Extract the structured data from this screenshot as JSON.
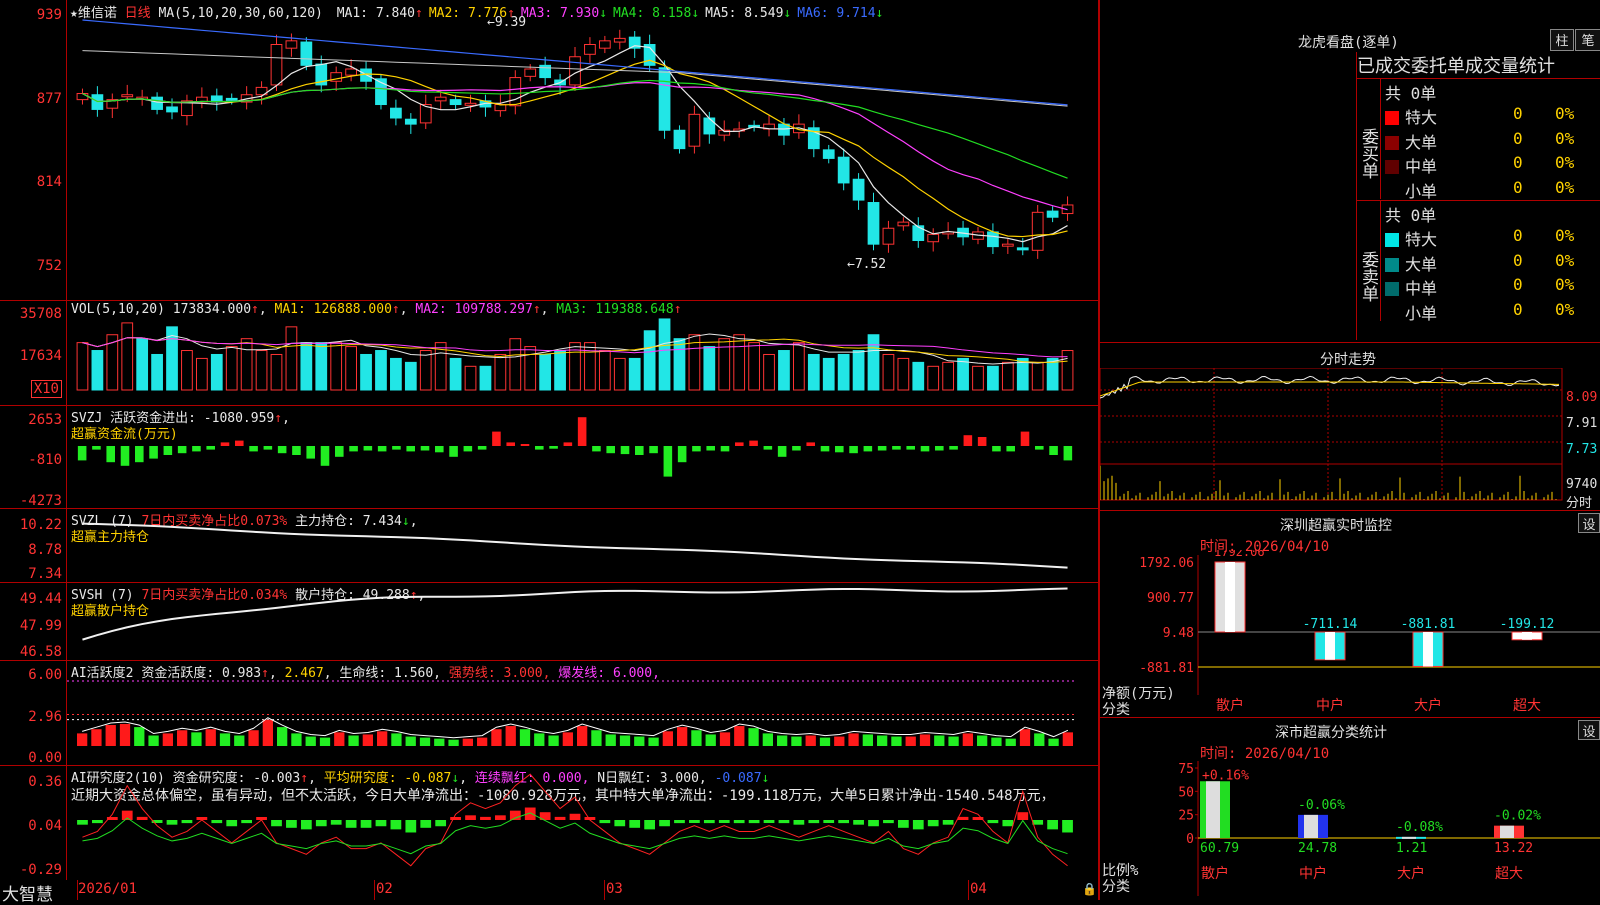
{
  "app": {
    "brand": "大智慧",
    "stock_name": "★维信诺",
    "period": "日线"
  },
  "kline": {
    "ma_label": "MA(5,10,20,30,60,120)",
    "ma": [
      {
        "name": "MA1:",
        "value": "7.840",
        "arrow": "↑",
        "color": "#e8e8e8"
      },
      {
        "name": "MA2:",
        "value": "7.776",
        "arrow": "↑",
        "color": "#ffd200"
      },
      {
        "name": "MA3:",
        "value": "7.930",
        "arrow": "↓",
        "color": "#ff40ff"
      },
      {
        "name": "MA4:",
        "value": "8.158",
        "arrow": "↓",
        "color": "#22dd22"
      },
      {
        "name": "MA5:",
        "value": "8.549",
        "arrow": "↓",
        "color": "#e8e8e8"
      },
      {
        "name": "MA6:",
        "value": "9.714",
        "arrow": "↓",
        "color": "#3a6bff"
      }
    ],
    "yticks": [
      "939",
      "877",
      "814",
      "752"
    ],
    "high_mark": "9.39",
    "low_mark": "7.52",
    "closes": [
      8.85,
      8.72,
      8.8,
      8.84,
      8.82,
      8.72,
      8.7,
      8.79,
      8.82,
      8.78,
      8.8,
      8.84,
      8.9,
      9.25,
      9.28,
      9.08,
      8.92,
      9.02,
      9.05,
      8.95,
      8.76,
      8.65,
      8.6,
      8.76,
      8.82,
      8.76,
      8.77,
      8.74,
      8.76,
      8.98,
      9.05,
      8.98,
      8.92,
      9.15,
      9.25,
      9.28,
      9.3,
      9.22,
      9.08,
      8.55,
      8.4,
      8.68,
      8.52,
      8.55,
      8.56,
      8.58,
      8.6,
      8.51,
      8.6,
      8.4,
      8.32,
      8.12,
      7.98,
      7.62,
      7.75,
      7.8,
      7.65,
      7.7,
      7.72,
      7.68,
      7.72,
      7.6,
      7.62,
      7.58,
      7.88,
      7.84,
      7.94
    ]
  },
  "volume": {
    "label": "VOL(5,10,20)",
    "value": "173834.000",
    "value_arrow": "↑",
    "ma1": "MA1: 126888.000",
    "ma1_arrow": "↑",
    "ma2": "MA2: 109788.297",
    "ma2_arrow": "↑",
    "ma3": "MA3: 119388.648",
    "ma3_arrow": "↑",
    "yticks": [
      "35708",
      "17634"
    ],
    "unit": "X10",
    "bars": [
      12,
      10,
      14,
      17,
      13,
      9,
      16,
      10,
      8,
      9,
      11,
      13,
      10,
      9,
      16,
      12,
      12,
      12,
      11,
      9,
      10,
      8,
      7,
      10,
      12,
      8,
      6,
      6,
      9,
      13,
      11,
      9,
      10,
      12,
      12,
      10,
      8,
      8,
      15,
      18,
      13,
      14,
      11,
      13,
      14,
      12,
      9,
      10,
      12,
      9,
      8,
      9,
      10,
      14,
      9,
      8,
      7,
      6,
      7,
      8,
      6,
      6,
      7,
      8,
      7,
      8,
      10
    ]
  },
  "svzj": {
    "label": "SVZJ",
    "title": "活跃资金进出:",
    "value": "-1080.959",
    "value_arrow": "↑",
    "subtitle": "超赢资金流(万元)",
    "yticks": [
      "2653",
      "-810",
      "-4273"
    ],
    "values": [
      -800,
      -200,
      -900,
      -1100,
      -900,
      -700,
      -500,
      -400,
      -300,
      -200,
      200,
      300,
      -300,
      -200,
      -400,
      -500,
      -700,
      -1100,
      -600,
      -300,
      -250,
      -300,
      -200,
      -300,
      -250,
      -350,
      -600,
      -300,
      -200,
      800,
      200,
      100,
      -200,
      -150,
      200,
      1600,
      -300,
      -400,
      -450,
      -500,
      -400,
      -1700,
      -900,
      -300,
      -250,
      -300,
      200,
      300,
      -200,
      -600,
      -250,
      200,
      -300,
      -350,
      -400,
      -300,
      -250,
      -200,
      -200,
      -300,
      -250,
      -200,
      600,
      500,
      -300,
      -300,
      800,
      -200,
      -500,
      -800
    ]
  },
  "svzl": {
    "label": "SVZL (7)",
    "ratio": "7日内买卖净占比0.073%",
    "title": "主力持仓:",
    "value": "7.434",
    "value_arrow": "↓",
    "subtitle": "超赢主力持仓",
    "yticks": [
      "10.22",
      "8.78",
      "7.34"
    ]
  },
  "svsh": {
    "label": "SVSH (7)",
    "ratio": "7日内买卖净占比0.034%",
    "title": "散户持仓:",
    "value": "49.288",
    "value_arrow": "↑",
    "subtitle": "超赢散户持仓",
    "yticks": [
      "49.44",
      "47.99",
      "46.58"
    ]
  },
  "ai_active": {
    "label": "AI活跃度2",
    "title": "资金活跃度:",
    "value": "0.983",
    "value_arrow": "↑",
    "v2": "2.467",
    "lifeline": "生命线: 1.560,",
    "strong": "强势线: 3.000,",
    "burst": "爆发线: 6.000,",
    "yticks": [
      "6.00",
      "2.96",
      "0.00"
    ],
    "values": [
      1.2,
      1.6,
      2.0,
      2.1,
      1.8,
      1.0,
      1.2,
      1.5,
      1.3,
      1.6,
      1.2,
      1.0,
      1.5,
      2.5,
      1.8,
      1.2,
      0.9,
      0.8,
      1.3,
      1.0,
      1.1,
      1.4,
      1.2,
      0.9,
      0.8,
      0.7,
      0.6,
      0.7,
      0.8,
      1.6,
      1.9,
      1.6,
      1.2,
      1.0,
      1.3,
      1.9,
      1.5,
      1.1,
      1.0,
      0.9,
      0.8,
      1.4,
      1.8,
      1.5,
      1.1,
      1.3,
      1.9,
      1.7,
      1.2,
      1.0,
      0.9,
      1.0,
      0.8,
      0.9,
      1.2,
      1.1,
      1.0,
      0.9,
      0.9,
      1.1,
      1.0,
      0.9,
      1.2,
      1.0,
      0.8,
      0.7,
      1.6,
      1.2,
      0.7,
      1.3
    ]
  },
  "ai_research": {
    "label": "AI研究度2(10)",
    "title": "资金研究度:",
    "value": "-0.003",
    "value_arrow": "↑",
    "avg": "平均研究度: -0.087",
    "avg_arrow": "↓",
    "red": "连续飘红: 0.000,",
    "ngreen": "N日飘红: 3.000,",
    "last": "-0.087",
    "last_arrow": "↓",
    "yticks": [
      "0.36",
      "0.04",
      "-0.29"
    ],
    "comment": "近期大资金总体偏空，虽有异动，但不太活跃，今日大单净流出：-1080.928万元，其中特大单净流出：-199.118万元，大单5日累计净出-1540.548万元，",
    "values": [
      -0.03,
      -0.02,
      0.01,
      0.06,
      0.02,
      -0.01,
      -0.03,
      -0.02,
      0.0,
      -0.02,
      -0.04,
      -0.02,
      0.0,
      -0.04,
      -0.05,
      -0.06,
      -0.04,
      -0.03,
      -0.05,
      -0.05,
      -0.04,
      -0.06,
      -0.08,
      -0.05,
      -0.04,
      0.01,
      0.03,
      0.02,
      0.03,
      0.06,
      0.08,
      0.05,
      0.02,
      0.04,
      0.0,
      -0.02,
      -0.04,
      -0.05,
      -0.06,
      -0.04,
      -0.02,
      -0.01,
      -0.02,
      -0.01,
      -0.02,
      -0.02,
      -0.01,
      -0.02,
      -0.03,
      -0.02,
      -0.01,
      -0.02,
      -0.03,
      -0.04,
      -0.02,
      -0.05,
      -0.06,
      -0.04,
      -0.03,
      0.02,
      0.01,
      -0.02,
      -0.04,
      0.05,
      -0.03,
      -0.06,
      -0.08
    ]
  },
  "xaxis": [
    "2026/01",
    "02",
    "03",
    "04"
  ],
  "right": {
    "lhkp_title": "龙虎看盘(逐单)",
    "btn_column": "柱",
    "btn_stroke": "笔",
    "tabs": "已成交委托单成交量统计",
    "buy_label": "委买单",
    "sell_label": "委卖单",
    "buy_total": "共 0单",
    "sell_total": "共 0单",
    "buy_rows": [
      {
        "name": "特大",
        "count": "0",
        "pct": "0%",
        "color": "#ff0000"
      },
      {
        "name": "大单",
        "count": "0",
        "pct": "0%",
        "color": "#8b0000"
      },
      {
        "name": "中单",
        "count": "0",
        "pct": "0%",
        "color": "#600000"
      },
      {
        "name": "小单",
        "count": "0",
        "pct": "0%",
        "color": "#000000"
      }
    ],
    "sell_rows": [
      {
        "name": "特大",
        "count": "0",
        "pct": "0%",
        "color": "#00e5e5"
      },
      {
        "name": "大单",
        "count": "0",
        "pct": "0%",
        "color": "#008a8a"
      },
      {
        "name": "中单",
        "count": "0",
        "pct": "0%",
        "color": "#006b6b"
      },
      {
        "name": "小单",
        "count": "0",
        "pct": "0%",
        "color": "#000000"
      }
    ],
    "intraday_title": "分时走势",
    "intraday_yticks": [
      "8.09",
      "7.91",
      "7.73"
    ],
    "intraday_vol": "9740",
    "intraday_vol_unit": "分时",
    "sz_title": "深圳超赢实时监控",
    "set_btn": "设",
    "sz_time": "时间: 2026/04/10",
    "sz_top": "1792.06",
    "sz_yticks": [
      "1792.06",
      "900.77",
      "9.48",
      "-881.81"
    ],
    "sz_ylabel": "净额(万元)",
    "sz_xlabel": "分类",
    "sz_values": [
      1792.06,
      -711.14,
      -881.81,
      -199.12
    ],
    "sz_labels": [
      "-711.14",
      "-881.81",
      "-199.12"
    ],
    "categories": [
      "散户",
      "中户",
      "大户",
      "超大"
    ],
    "cls_title": "深市超赢分类统计",
    "cls_time": "时间: 2026/04/10",
    "cls_yticks": [
      "75",
      "50",
      "25",
      "0"
    ],
    "cls_top_labels": [
      "+0.16%",
      "-0.06%",
      "-0.08%",
      "-0.02%"
    ],
    "cls_values": [
      60.79,
      24.78,
      1.21,
      13.22
    ],
    "cls_value_labels": [
      "60.79",
      "24.78",
      "1.21",
      "13.22"
    ],
    "cls_ylabel": "比例%",
    "cls_xlabel": "分类"
  }
}
